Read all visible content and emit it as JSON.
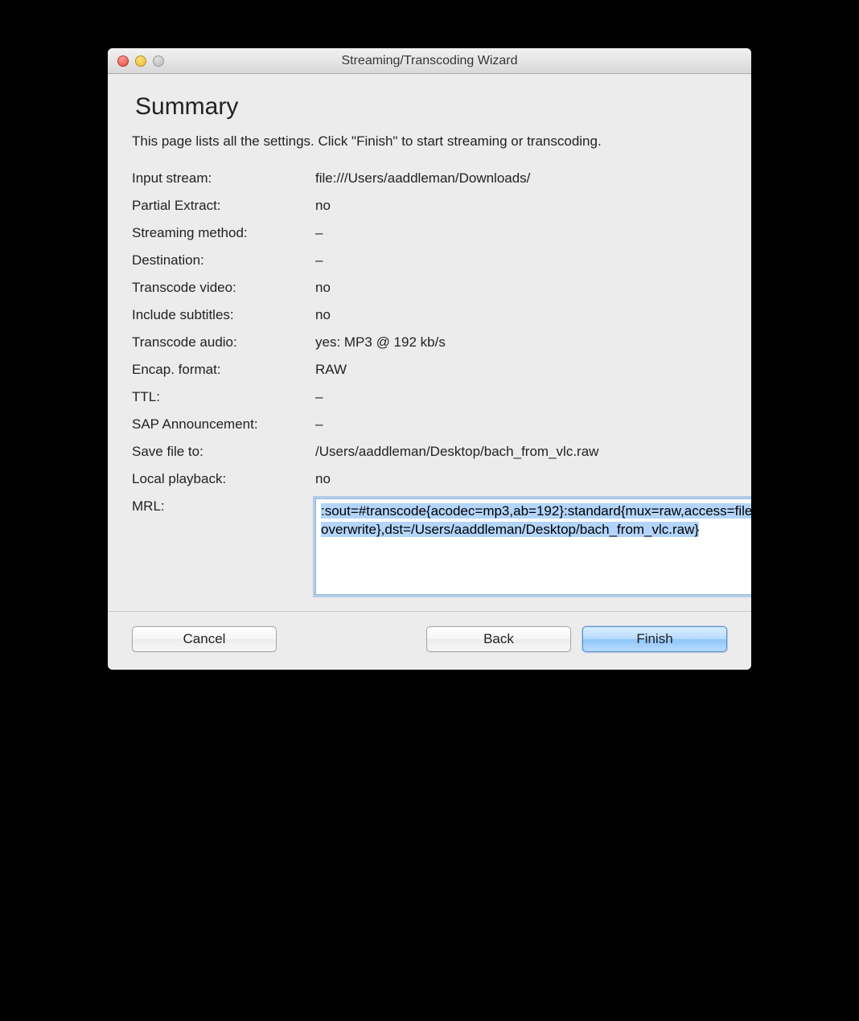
{
  "window": {
    "title": "Streaming/Transcoding Wizard"
  },
  "page": {
    "heading": "Summary",
    "description": "This page lists all the settings. Click \"Finish\" to start streaming or transcoding."
  },
  "summary": {
    "input_stream": {
      "label": "Input stream:",
      "value": "file:///Users/aaddleman/Downloads/"
    },
    "partial_extract": {
      "label": "Partial Extract:",
      "value": "no"
    },
    "streaming_method": {
      "label": "Streaming method:",
      "value": "–"
    },
    "destination": {
      "label": "Destination:",
      "value": "–"
    },
    "transcode_video": {
      "label": "Transcode video:",
      "value": "no"
    },
    "include_subtitles": {
      "label": "Include subtitles:",
      "value": "no"
    },
    "transcode_audio": {
      "label": "Transcode audio:",
      "value": "yes: MP3 @ 192 kb/s"
    },
    "encap_format": {
      "label": "Encap. format:",
      "value": "RAW"
    },
    "ttl": {
      "label": "TTL:",
      "value": "–"
    },
    "sap_announcement": {
      "label": "SAP Announcement:",
      "value": "–"
    },
    "save_file_to": {
      "label": "Save file to:",
      "value": "/Users/aaddleman/Desktop/bach_from_vlc.raw"
    },
    "local_playback": {
      "label": "Local playback:",
      "value": "no"
    },
    "mrl": {
      "label": "MRL:",
      "value": ":sout=#transcode{acodec=mp3,ab=192}:standard{mux=raw,access=file{no-overwrite},dst=/Users/aaddleman/Desktop/bach_from_vlc.raw}"
    }
  },
  "buttons": {
    "cancel": "Cancel",
    "back": "Back",
    "finish": "Finish"
  }
}
